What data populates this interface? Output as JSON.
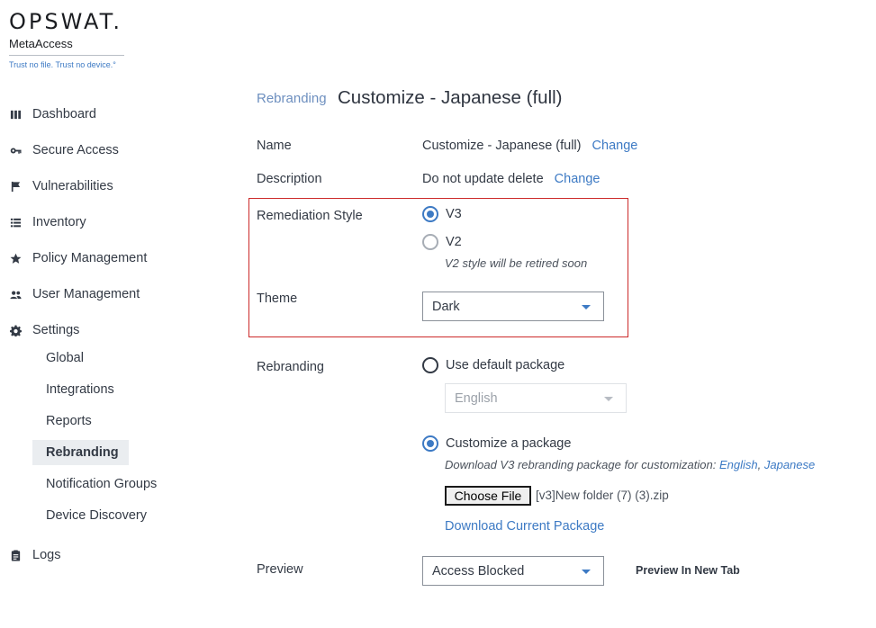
{
  "brand": {
    "logo": "OPSWAT.",
    "product": "MetaAccess",
    "tagline": "Trust no file. Trust no device.°"
  },
  "sidebar": {
    "items": [
      {
        "label": "Dashboard",
        "icon": "columns-icon"
      },
      {
        "label": "Secure Access",
        "icon": "key-icon"
      },
      {
        "label": "Vulnerabilities",
        "icon": "flag-icon"
      },
      {
        "label": "Inventory",
        "icon": "list-icon"
      },
      {
        "label": "Policy Management",
        "icon": "star-icon"
      },
      {
        "label": "User Management",
        "icon": "users-icon"
      },
      {
        "label": "Settings",
        "icon": "gear-icon"
      },
      {
        "label": "Logs",
        "icon": "clipboard-icon"
      }
    ],
    "settings_sub": [
      {
        "label": "Global"
      },
      {
        "label": "Integrations"
      },
      {
        "label": "Reports"
      },
      {
        "label": "Rebranding",
        "active": true
      },
      {
        "label": "Notification Groups"
      },
      {
        "label": "Device Discovery"
      }
    ]
  },
  "header": {
    "breadcrumb": "Rebranding",
    "title": "Customize - Japanese (full)"
  },
  "form": {
    "name_label": "Name",
    "name_value": "Customize - Japanese (full)",
    "name_change": "Change",
    "description_label": "Description",
    "description_value": "Do not update delete",
    "description_change": "Change",
    "remediation_label": "Remediation Style",
    "remediation_options": [
      {
        "label": "V3",
        "selected": true
      },
      {
        "label": "V2",
        "selected": false
      }
    ],
    "remediation_note": "V2 style will be retired soon",
    "theme_label": "Theme",
    "theme_value": "Dark",
    "rebranding_label": "Rebranding",
    "use_default_label": "Use default package",
    "use_default_selected": false,
    "default_language": "English",
    "customize_label": "Customize a package",
    "customize_selected": true,
    "download_note": "Download V3 rebranding package for customization:",
    "download_english": "English",
    "download_separator": ",",
    "download_japanese": "Japanese",
    "choose_file_label": "Choose File",
    "chosen_file": "[v3]New folder (7) (3).zip",
    "download_current": "Download Current Package",
    "preview_label": "Preview",
    "preview_value": "Access Blocked",
    "preview_new_tab": "Preview In New Tab"
  },
  "colors": {
    "accent": "#3d7ac4",
    "highlight_border": "#cc2a2a",
    "active_bg": "#eaedf0"
  }
}
